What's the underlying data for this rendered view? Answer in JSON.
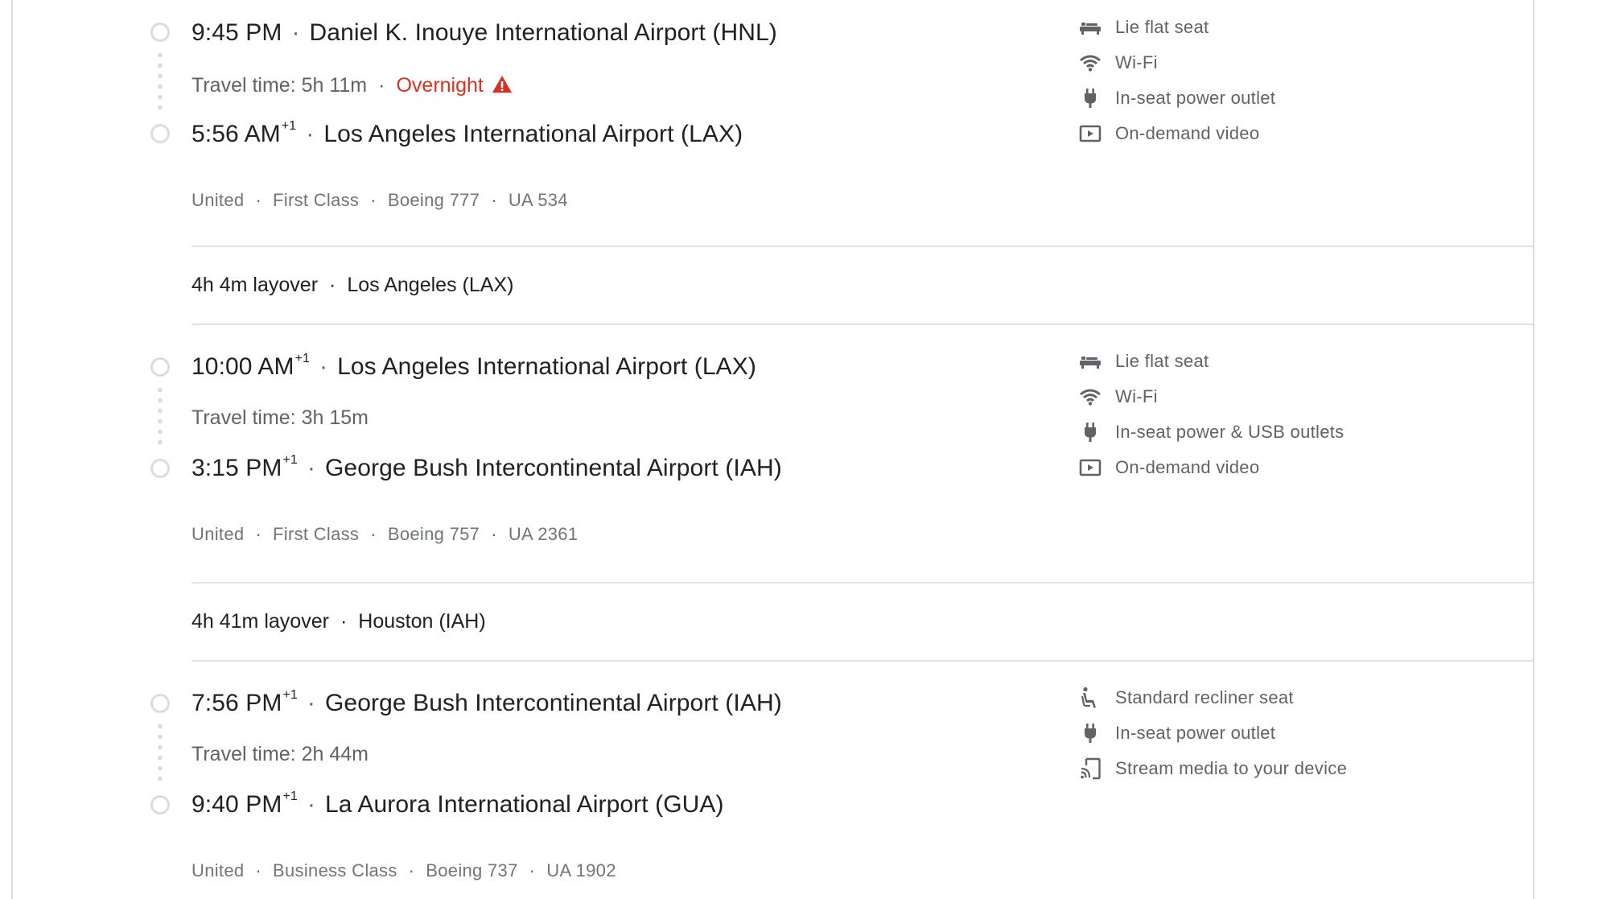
{
  "segments": [
    {
      "depart": {
        "time": "9:45 PM",
        "plus": "",
        "airport": "Daniel K. Inouye International Airport (HNL)"
      },
      "travel_time": "Travel time: 5h 11m",
      "overnight": "Overnight",
      "arrive": {
        "time": "5:56 AM",
        "plus": "+1",
        "airport": "Los Angeles International Airport (LAX)"
      },
      "info": {
        "airline": "United",
        "cabin": "First Class",
        "aircraft": "Boeing 777",
        "flight": "UA 534"
      },
      "amenities": [
        {
          "icon": "lie-flat-seat-icon",
          "label": "Lie flat seat"
        },
        {
          "icon": "wifi-icon",
          "label": "Wi-Fi"
        },
        {
          "icon": "power-outlet-icon",
          "label": "In-seat power outlet"
        },
        {
          "icon": "on-demand-video-icon",
          "label": "On-demand video"
        }
      ]
    },
    {
      "depart": {
        "time": "10:00 AM",
        "plus": "+1",
        "airport": "Los Angeles International Airport (LAX)"
      },
      "travel_time": "Travel time: 3h 15m",
      "arrive": {
        "time": "3:15 PM",
        "plus": "+1",
        "airport": "George Bush Intercontinental Airport (IAH)"
      },
      "info": {
        "airline": "United",
        "cabin": "First Class",
        "aircraft": "Boeing 757",
        "flight": "UA 2361"
      },
      "amenities": [
        {
          "icon": "lie-flat-seat-icon",
          "label": "Lie flat seat"
        },
        {
          "icon": "wifi-icon",
          "label": "Wi-Fi"
        },
        {
          "icon": "power-outlet-icon",
          "label": "In-seat power & USB outlets"
        },
        {
          "icon": "on-demand-video-icon",
          "label": "On-demand video"
        }
      ]
    },
    {
      "depart": {
        "time": "7:56 PM",
        "plus": "+1",
        "airport": "George Bush Intercontinental Airport (IAH)"
      },
      "travel_time": "Travel time: 2h 44m",
      "arrive": {
        "time": "9:40 PM",
        "plus": "+1",
        "airport": "La Aurora International Airport (GUA)"
      },
      "info": {
        "airline": "United",
        "cabin": "Business Class",
        "aircraft": "Boeing 737",
        "flight": "UA 1902"
      },
      "amenities": [
        {
          "icon": "recliner-seat-icon",
          "label": "Standard recliner seat"
        },
        {
          "icon": "power-outlet-icon",
          "label": "In-seat power outlet"
        },
        {
          "icon": "stream-media-icon",
          "label": "Stream media to your device"
        }
      ]
    }
  ],
  "layovers": [
    {
      "duration": "4h 4m layover",
      "place": "Los Angeles (LAX)"
    },
    {
      "duration": "4h 41m layover",
      "place": "Houston (IAH)"
    }
  ],
  "colors": {
    "warning": "#d93025",
    "text_primary": "#202124",
    "text_secondary": "#5f6368",
    "divider": "#dadce0"
  }
}
